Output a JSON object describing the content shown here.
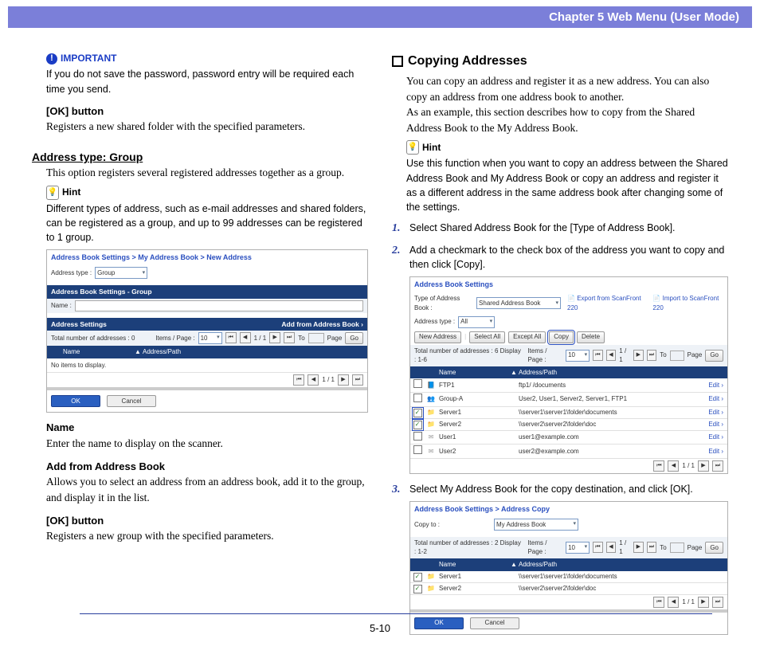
{
  "header": "Chapter 5   Web Menu (User Mode)",
  "left": {
    "important_label": "IMPORTANT",
    "important_text": "If you do not save the password, password entry will be required each time you send.",
    "ok_title": "[OK] button",
    "ok_text": "Registers a new shared folder with the specified parameters.",
    "group_title": "Address type: Group",
    "group_text": "This option registers several registered addresses together as a group.",
    "hint_label": "Hint",
    "hint_text": "Different types of address, such as e-mail addresses and shared folders, can be registered as a group, and up to 99 addresses can be registered to 1 group.",
    "ss1": {
      "breadcrumb": "Address Book Settings > My Address Book > New Address",
      "addr_type_label": "Address type :",
      "addr_type_value": "Group",
      "header1_left": "Address Book Settings - Group",
      "name_label": "Name :",
      "header2_left": "Address Settings",
      "header2_right": "Add from Address Book ›",
      "total_label": "Total number of addresses : 0",
      "items_label": "Items / Page :",
      "items_value": "10",
      "page_text": "1 / 1",
      "to_label": "To",
      "page_label": "Page",
      "go_label": "Go",
      "th_name": "Name",
      "th_path": "Address/Path",
      "no_items": "No items to display.",
      "ok": "OK",
      "cancel": "Cancel"
    },
    "name_title": "Name",
    "name_text": "Enter the name to display on the scanner.",
    "add_title": "Add from Address Book",
    "add_text": "Allows you to select an address from an address book, add it to the group, and display it in the list.",
    "ok2_title": "[OK] button",
    "ok2_text": "Registers a new group with the specified parameters."
  },
  "right": {
    "title": "Copying Addresses",
    "intro1": "You can copy an address and register it as a new address. You can also copy an address from one address book to another.",
    "intro2": "As an example, this section describes how to copy from the Shared Address Book to the My Address Book.",
    "hint_label": "Hint",
    "hint_text": "Use this function when you want to copy an address between the Shared Address Book and My Address Book or copy an address and register it as a different address in the same address book after changing some of the settings.",
    "step1": "Select Shared Address Book for the [Type of Address Book].",
    "step2": "Add a checkmark to the check box of the address you want to copy and then click [Copy].",
    "ss2": {
      "breadcrumb": "Address Book Settings",
      "type_label": "Type of Address Book :",
      "type_value": "Shared Address Book",
      "export_link": "Export from ScanFront 220",
      "import_link": "Import to ScanFront 220",
      "addr_type_label": "Address type :",
      "addr_type_value": "All",
      "new_addr": "New Address",
      "select_all": "Select All",
      "except_all": "Except All",
      "copy": "Copy",
      "delete": "Delete",
      "total_label": "Total number of addresses : 6 Display : 1-6",
      "items_label": "Items / Page :",
      "items_value": "10",
      "page_text": "1 / 1",
      "to_label": "To",
      "page_label": "Page",
      "go_label": "Go",
      "th_name": "Name",
      "th_path": "Address/Path",
      "edit": "Edit ›",
      "rows": [
        {
          "checked": false,
          "hl": false,
          "icon": "ftp",
          "name": "FTP1",
          "path": "ftp1/                    /documents"
        },
        {
          "checked": false,
          "hl": false,
          "icon": "group",
          "name": "Group-A",
          "path": "User2, User1, Server2, Server1, FTP1"
        },
        {
          "checked": true,
          "hl": true,
          "icon": "folder",
          "name": "Server1",
          "path": "\\\\server1\\server1\\folder\\documents"
        },
        {
          "checked": true,
          "hl": true,
          "icon": "folder",
          "name": "Server2",
          "path": "\\\\server2\\server2\\folder\\doc"
        },
        {
          "checked": false,
          "hl": false,
          "icon": "mail",
          "name": "User1",
          "path": "user1@example.com"
        },
        {
          "checked": false,
          "hl": false,
          "icon": "mail",
          "name": "User2",
          "path": "user2@example.com"
        }
      ]
    },
    "step3": "Select My Address Book for the copy destination, and click [OK].",
    "ss3": {
      "breadcrumb": "Address Book Settings > Address Copy",
      "copy_to_label": "Copy to :",
      "copy_to_value": "My Address Book",
      "total_label": "Total number of addresses : 2 Display : 1-2",
      "items_label": "Items / Page :",
      "items_value": "10",
      "page_text": "1 / 1",
      "to_label": "To",
      "page_label": "Page",
      "go_label": "Go",
      "th_name": "Name",
      "th_path": "Address/Path",
      "rows": [
        {
          "name": "Server1",
          "path": "\\\\server1\\server1\\folder\\documents"
        },
        {
          "name": "Server2",
          "path": "\\\\server2\\server2\\folder\\doc"
        }
      ],
      "ok": "OK",
      "cancel": "Cancel"
    }
  },
  "page_number": "5-10"
}
